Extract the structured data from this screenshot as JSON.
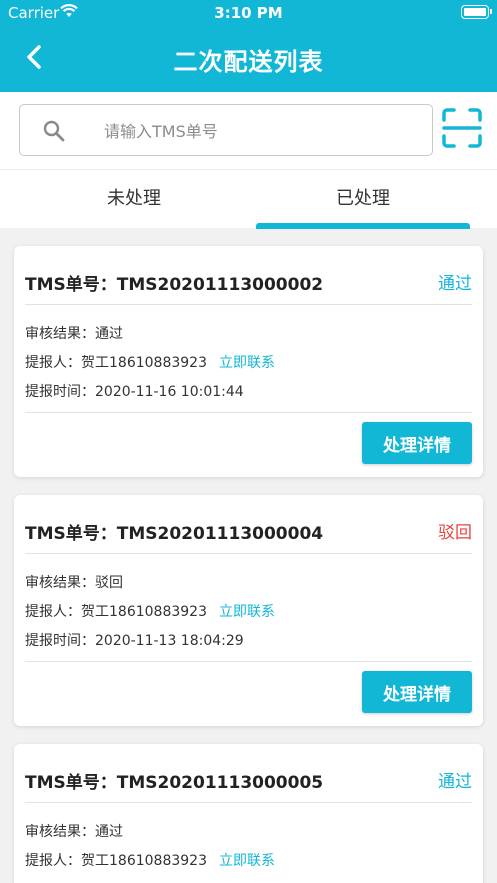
{
  "status_bar": {
    "carrier": "Carrier",
    "time": "3:10 PM"
  },
  "nav": {
    "title": "二次配送列表"
  },
  "search": {
    "placeholder": "请输入TMS单号"
  },
  "tabs": [
    {
      "label": "未处理"
    },
    {
      "label": "已处理"
    }
  ],
  "active_tab": "已处理",
  "records": [
    {
      "title": "TMS单号：TMS20201113000002",
      "status": "通过",
      "result_label": "审核结果：",
      "result_value": "通过",
      "submitter_label": "提报人：",
      "submitter_value": "贺工18610883923",
      "contact_label": "立即联系",
      "time_label": "提报时间：",
      "time_value": "2020-11-16 10:01:44",
      "button_label": "处理详情"
    },
    {
      "title": "TMS单号：TMS20201113000004",
      "status": "驳回",
      "result_label": "审核结果：",
      "result_value": "驳回",
      "submitter_label": "提报人：",
      "submitter_value": "贺工18610883923",
      "contact_label": "立即联系",
      "time_label": "提报时间：",
      "time_value": "2020-11-13 18:04:29",
      "button_label": "处理详情"
    },
    {
      "title": "TMS单号：TMS20201113000005",
      "status": "通过",
      "result_label": "审核结果：",
      "result_value": "通过",
      "submitter_label": "提报人：",
      "submitter_value": "贺工18610883923",
      "contact_label": "立即联系"
    }
  ],
  "colors": {
    "accent": "#12b7d6",
    "reject": "#e64340"
  },
  "icons": {
    "back": "chevron-left-icon",
    "search": "search-icon",
    "scan": "scan-icon",
    "wifi": "wifi-icon",
    "battery": "battery-icon"
  }
}
